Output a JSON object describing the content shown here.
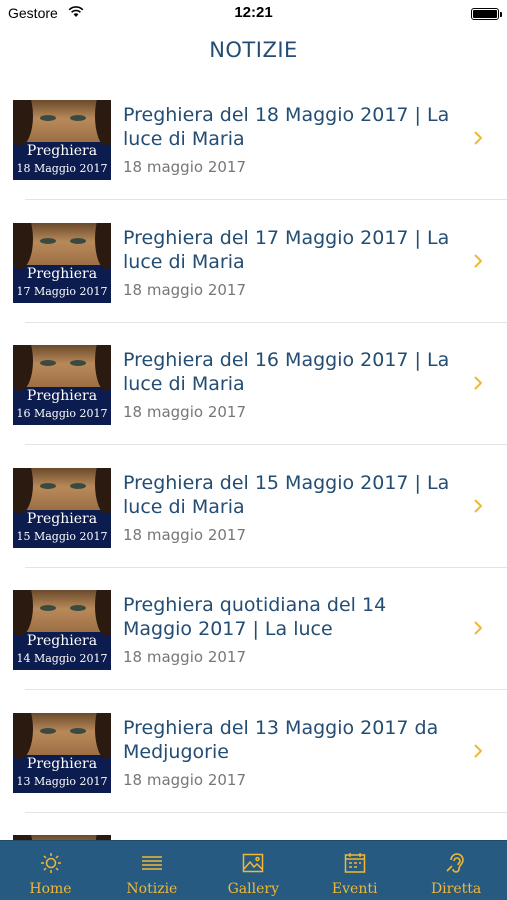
{
  "status_bar": {
    "carrier": "Gestore",
    "time": "12:21"
  },
  "nav": {
    "title": "NOTIZIE"
  },
  "articles": [
    {
      "title": "Preghiera del 18 Maggio 2017 | La luce di Maria",
      "date": "18 maggio 2017",
      "thumb_label": "Preghiera",
      "thumb_date": "18 Maggio 2017"
    },
    {
      "title": "Preghiera del 17 Maggio 2017 | La luce di Maria",
      "date": "18 maggio 2017",
      "thumb_label": "Preghiera",
      "thumb_date": "17 Maggio 2017"
    },
    {
      "title": "Preghiera del 16 Maggio 2017 | La luce di Maria",
      "date": "18 maggio 2017",
      "thumb_label": "Preghiera",
      "thumb_date": "16 Maggio 2017"
    },
    {
      "title": "Preghiera del 15 Maggio 2017 | La luce di Maria",
      "date": "18 maggio 2017",
      "thumb_label": "Preghiera",
      "thumb_date": "15 Maggio 2017"
    },
    {
      "title": "Preghiera quotidiana del 14 Maggio 2017 | La luce",
      "date": "18 maggio 2017",
      "thumb_label": "Preghiera",
      "thumb_date": "14 Maggio 2017"
    },
    {
      "title": "Preghiera del 13 Maggio 2017 da Medjugorie",
      "date": "18 maggio 2017",
      "thumb_label": "Preghiera",
      "thumb_date": "13 Maggio 2017"
    }
  ],
  "tabbar": {
    "tabs": [
      {
        "label": "Home",
        "icon": "sun-icon"
      },
      {
        "label": "Notizie",
        "icon": "list-icon"
      },
      {
        "label": "Gallery",
        "icon": "image-icon"
      },
      {
        "label": "Eventi",
        "icon": "calendar-icon"
      },
      {
        "label": "Diretta",
        "icon": "ear-icon"
      }
    ],
    "selected": "Notizie"
  },
  "colors": {
    "accent": "#f2b733",
    "tabbar_bg": "#265a80",
    "title": "#234d73",
    "chevron": "#f2b733"
  }
}
